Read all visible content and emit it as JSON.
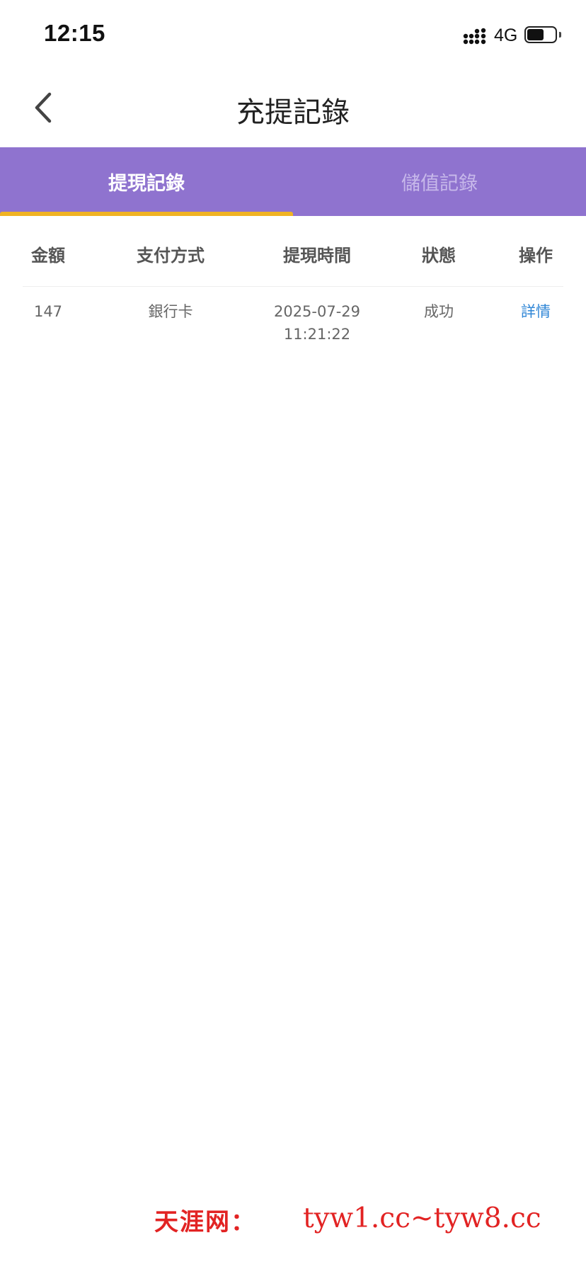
{
  "status_bar": {
    "time": "12:15",
    "network": "4G",
    "battery_level": 0.6,
    "icons": [
      "signal-icon",
      "battery-icon"
    ]
  },
  "nav": {
    "back_icon": "chevron-left-icon",
    "title": "充提記錄"
  },
  "tabs": [
    {
      "label": "提現記錄",
      "active": true
    },
    {
      "label": "儲值記錄",
      "active": false
    }
  ],
  "colors": {
    "tab_bar": "#8f73cf",
    "tab_indicator": "#f0b323",
    "link": "#2f86d6",
    "watermark": "#e22323"
  },
  "table": {
    "columns": [
      "金額",
      "支付方式",
      "提現時間",
      "狀態",
      "操作"
    ],
    "rows": [
      {
        "amount": "147",
        "method": "銀行卡",
        "date": "2025-07-29",
        "time": "11:21:22",
        "status": "成功",
        "action": "詳情"
      }
    ]
  },
  "watermark": {
    "site_name": "天涯网：",
    "urls": "tyw1.cc~tyw8.cc"
  }
}
